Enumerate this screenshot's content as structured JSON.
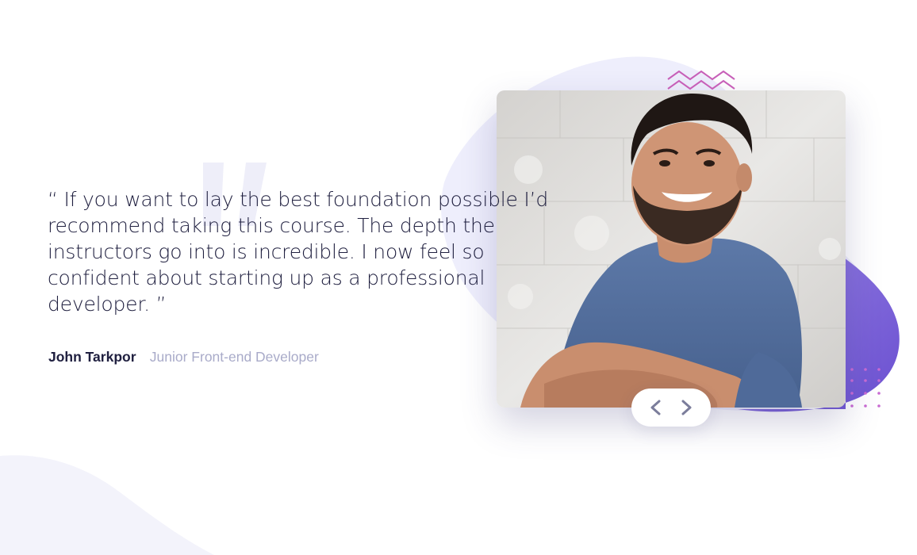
{
  "testimonial": {
    "quote": "“ If you want to lay the best foundation possible I’d recommend taking this course. The depth the instructors go into is incredible. I now feel so confident about starting up as a professional developer. ”",
    "author_name": "John Tarkpor",
    "author_role": "Junior Front-end Developer"
  },
  "navigation": {
    "prev_icon": "chevron-left-icon",
    "next_icon": "chevron-right-icon"
  },
  "colors": {
    "text_dark": "#202040",
    "text_muted": "#a9abc9",
    "blob_purple": "#7b5fd3",
    "blob_light": "#eeeefb",
    "accent_pink": "#c75fb8",
    "bg_curve": "#f4f4fb"
  }
}
